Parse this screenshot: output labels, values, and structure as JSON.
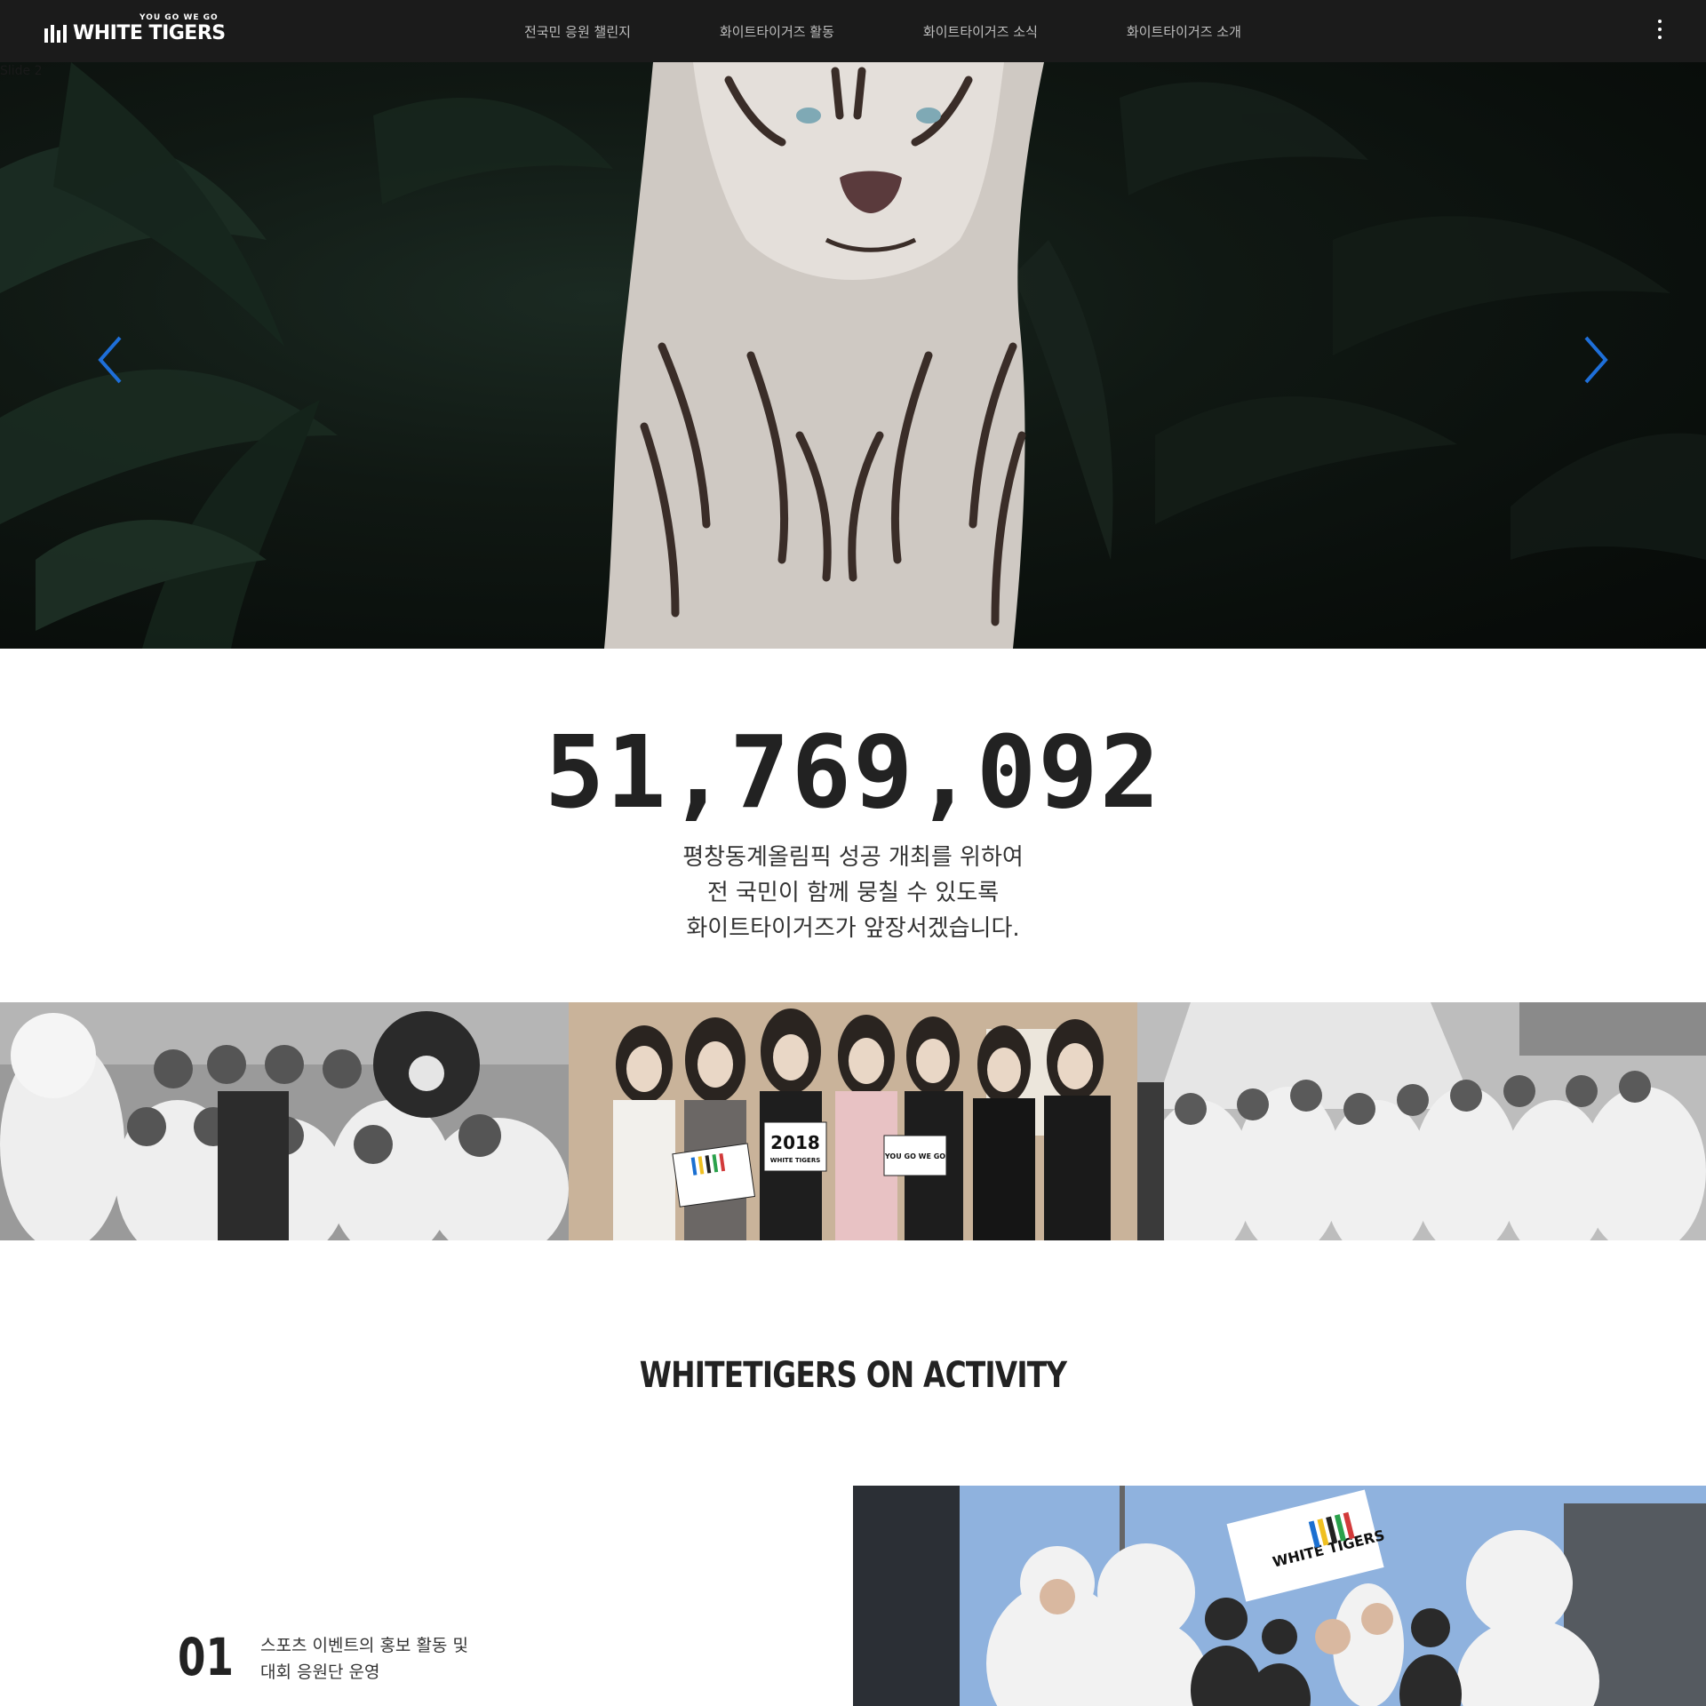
{
  "header": {
    "logo_tagline": "YOU GO WE GO",
    "logo_name": "WHITE TIGERS",
    "nav": [
      {
        "label": "전국민 응원 챌린지"
      },
      {
        "label": "화이트타이거즈 활동"
      },
      {
        "label": "화이트타이거즈 소식"
      },
      {
        "label": "화이트타이거즈 소개"
      }
    ],
    "menu_icon": "kebab-menu-icon"
  },
  "hero": {
    "slide_label": "Slide 2",
    "prev_icon": "chevron-left-icon",
    "next_icon": "chevron-right-icon",
    "arrow_color": "#1e6fd9"
  },
  "counter": {
    "value": "51,769,092"
  },
  "intro": {
    "lines": [
      "평창동계올림픽 성공 개최를 위하여",
      "전 국민이 함께 뭉칠 수 있도록",
      "화이트타이거즈가 앞장서겠습니다."
    ]
  },
  "photos": {
    "sign_2018": "2018",
    "sign_wt": "WHITE TIGERS",
    "sign_ygwg": "YOU GO WE GO",
    "flag_text": "WHITE TIGERS"
  },
  "activity": {
    "title": "WHITETIGERS ON ACTIVITY",
    "items": [
      {
        "number": "01",
        "lines": [
          "스포츠 이벤트의 홍보 활동 및",
          "대회 응원단 운영"
        ]
      }
    ]
  }
}
